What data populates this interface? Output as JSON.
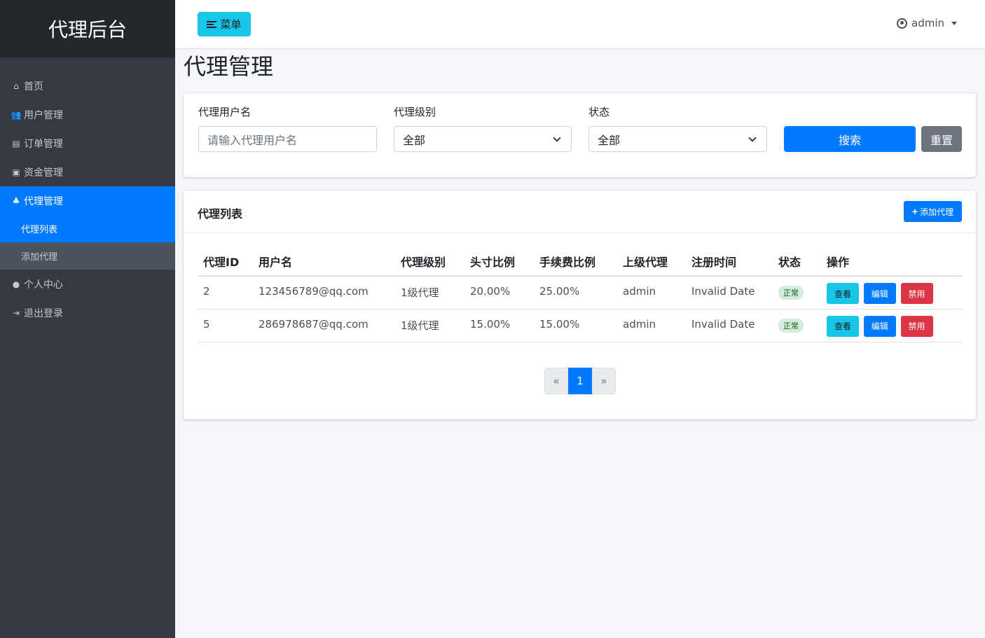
{
  "brand": "代理后台",
  "sidebar": {
    "items": [
      {
        "label": "首页",
        "icon": "home-icon"
      },
      {
        "label": "用户管理",
        "icon": "users-icon"
      },
      {
        "label": "订单管理",
        "icon": "file-icon"
      },
      {
        "label": "资金管理",
        "icon": "money-icon"
      },
      {
        "label": "代理管理",
        "icon": "sitemap-icon",
        "active": true
      },
      {
        "label": "个人中心",
        "icon": "user-icon"
      },
      {
        "label": "退出登录",
        "icon": "logout-icon"
      }
    ],
    "submenu": [
      {
        "label": "代理列表",
        "active": true
      },
      {
        "label": "添加代理"
      }
    ]
  },
  "topbar": {
    "menu_button": "菜单",
    "username": "admin"
  },
  "page": {
    "title": "代理管理"
  },
  "filters": {
    "username_label": "代理用户名",
    "username_placeholder": "请输入代理用户名",
    "level_label": "代理级别",
    "level_value": "全部",
    "status_label": "状态",
    "status_value": "全部",
    "search_button": "搜索",
    "reset_button": "重置"
  },
  "list": {
    "title": "代理列表",
    "add_button": "添加代理",
    "columns": [
      "代理ID",
      "用户名",
      "代理级别",
      "头寸比例",
      "手续费比例",
      "上级代理",
      "注册时间",
      "状态",
      "操作"
    ],
    "rows": [
      {
        "id": "2",
        "username": "123456789@qq.com",
        "level": "1级代理",
        "position_ratio": "20.00%",
        "fee_ratio": "25.00%",
        "parent": "admin",
        "registered": "Invalid Date",
        "status": "正常"
      },
      {
        "id": "5",
        "username": "286978687@qq.com",
        "level": "1级代理",
        "position_ratio": "15.00%",
        "fee_ratio": "15.00%",
        "parent": "admin",
        "registered": "Invalid Date",
        "status": "正常"
      }
    ],
    "actions": {
      "view": "查看",
      "edit": "编辑",
      "disable": "禁用"
    }
  },
  "pagination": {
    "prev": "«",
    "current": "1",
    "next": "»"
  },
  "colors": {
    "primary": "#007bff",
    "info": "#17c6e8",
    "danger": "#dc3545",
    "secondary": "#6c757d",
    "sidebar": "#343a40"
  }
}
